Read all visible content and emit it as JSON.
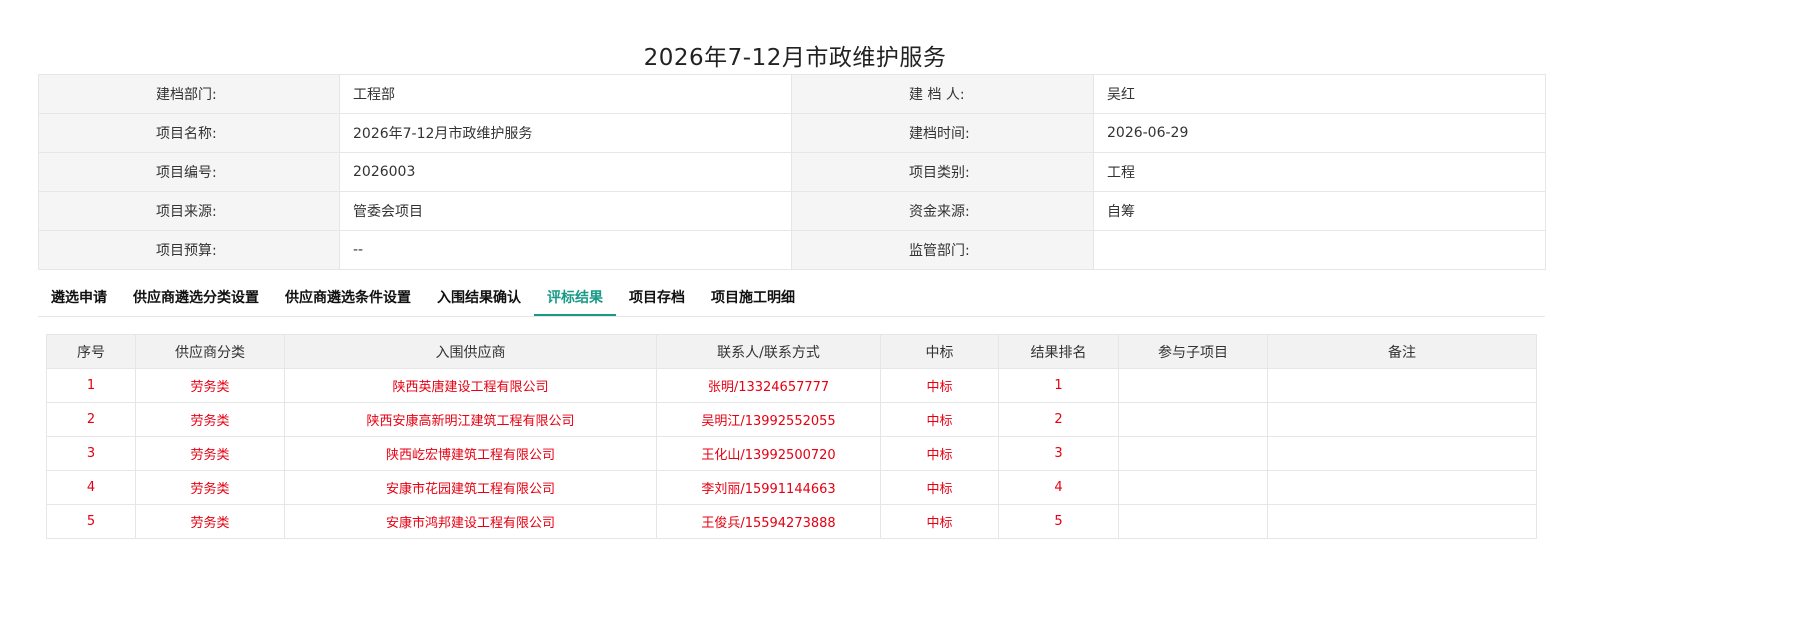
{
  "page": {
    "title": "2026年7-12月市政维护服务"
  },
  "info": {
    "rows": [
      {
        "label1": "建档部门:",
        "value1": "工程部",
        "label2": "建 档 人:",
        "value2": "吴红"
      },
      {
        "label1": "项目名称:",
        "value1": "2026年7-12月市政维护服务",
        "label2": "建档时间:",
        "value2": "2026-06-29"
      },
      {
        "label1": "项目编号:",
        "value1": "2026003",
        "label2": "项目类别:",
        "value2": "工程"
      },
      {
        "label1": "项目来源:",
        "value1": "管委会项目",
        "label2": "资金来源:",
        "value2": "自筹"
      },
      {
        "label1": "项目预算:",
        "value1": "--",
        "label2": "监管部门:",
        "value2": ""
      }
    ]
  },
  "tabs": {
    "items": [
      {
        "label": "遴选申请",
        "active": false
      },
      {
        "label": "供应商遴选分类设置",
        "active": false
      },
      {
        "label": "供应商遴选条件设置",
        "active": false
      },
      {
        "label": "入围结果确认",
        "active": false
      },
      {
        "label": "评标结果",
        "active": true
      },
      {
        "label": "项目存档",
        "active": false
      },
      {
        "label": "项目施工明细",
        "active": false
      }
    ],
    "active_color": "#1a9a86"
  },
  "results": {
    "headers": [
      "序号",
      "供应商分类",
      "入围供应商",
      "联系人/联系方式",
      "中标",
      "结果排名",
      "参与子项目",
      "备注"
    ],
    "rows": [
      [
        "1",
        "劳务类",
        "陕西英唐建设工程有限公司",
        "张明/13324657777",
        "中标",
        "1",
        "",
        ""
      ],
      [
        "2",
        "劳务类",
        "陕西安康高新明江建筑工程有限公司",
        "吴明江/13992552055",
        "中标",
        "2",
        "",
        ""
      ],
      [
        "3",
        "劳务类",
        "陕西屹宏博建筑工程有限公司",
        "王化山/13992500720",
        "中标",
        "3",
        "",
        ""
      ],
      [
        "4",
        "劳务类",
        "安康市花园建筑工程有限公司",
        "李刘丽/15991144663",
        "中标",
        "4",
        "",
        ""
      ],
      [
        "5",
        "劳务类",
        "安康市鸿邦建设工程有限公司",
        "王俊兵/15594273888",
        "中标",
        "5",
        "",
        ""
      ]
    ],
    "row_text_color": "#e60012"
  }
}
